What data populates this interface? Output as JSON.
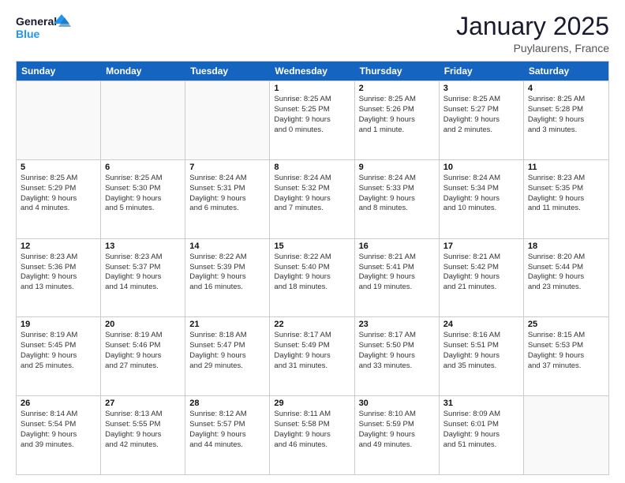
{
  "logo": {
    "line1": "General",
    "line2": "Blue"
  },
  "title": "January 2025",
  "subtitle": "Puylaurens, France",
  "header_days": [
    "Sunday",
    "Monday",
    "Tuesday",
    "Wednesday",
    "Thursday",
    "Friday",
    "Saturday"
  ],
  "weeks": [
    [
      {
        "day": "",
        "empty": true,
        "lines": []
      },
      {
        "day": "",
        "empty": true,
        "lines": []
      },
      {
        "day": "",
        "empty": true,
        "lines": []
      },
      {
        "day": "1",
        "lines": [
          "Sunrise: 8:25 AM",
          "Sunset: 5:25 PM",
          "Daylight: 9 hours",
          "and 0 minutes."
        ]
      },
      {
        "day": "2",
        "lines": [
          "Sunrise: 8:25 AM",
          "Sunset: 5:26 PM",
          "Daylight: 9 hours",
          "and 1 minute."
        ]
      },
      {
        "day": "3",
        "lines": [
          "Sunrise: 8:25 AM",
          "Sunset: 5:27 PM",
          "Daylight: 9 hours",
          "and 2 minutes."
        ]
      },
      {
        "day": "4",
        "lines": [
          "Sunrise: 8:25 AM",
          "Sunset: 5:28 PM",
          "Daylight: 9 hours",
          "and 3 minutes."
        ]
      }
    ],
    [
      {
        "day": "5",
        "lines": [
          "Sunrise: 8:25 AM",
          "Sunset: 5:29 PM",
          "Daylight: 9 hours",
          "and 4 minutes."
        ]
      },
      {
        "day": "6",
        "lines": [
          "Sunrise: 8:25 AM",
          "Sunset: 5:30 PM",
          "Daylight: 9 hours",
          "and 5 minutes."
        ]
      },
      {
        "day": "7",
        "lines": [
          "Sunrise: 8:24 AM",
          "Sunset: 5:31 PM",
          "Daylight: 9 hours",
          "and 6 minutes."
        ]
      },
      {
        "day": "8",
        "lines": [
          "Sunrise: 8:24 AM",
          "Sunset: 5:32 PM",
          "Daylight: 9 hours",
          "and 7 minutes."
        ]
      },
      {
        "day": "9",
        "lines": [
          "Sunrise: 8:24 AM",
          "Sunset: 5:33 PM",
          "Daylight: 9 hours",
          "and 8 minutes."
        ]
      },
      {
        "day": "10",
        "lines": [
          "Sunrise: 8:24 AM",
          "Sunset: 5:34 PM",
          "Daylight: 9 hours",
          "and 10 minutes."
        ]
      },
      {
        "day": "11",
        "lines": [
          "Sunrise: 8:23 AM",
          "Sunset: 5:35 PM",
          "Daylight: 9 hours",
          "and 11 minutes."
        ]
      }
    ],
    [
      {
        "day": "12",
        "lines": [
          "Sunrise: 8:23 AM",
          "Sunset: 5:36 PM",
          "Daylight: 9 hours",
          "and 13 minutes."
        ]
      },
      {
        "day": "13",
        "lines": [
          "Sunrise: 8:23 AM",
          "Sunset: 5:37 PM",
          "Daylight: 9 hours",
          "and 14 minutes."
        ]
      },
      {
        "day": "14",
        "lines": [
          "Sunrise: 8:22 AM",
          "Sunset: 5:39 PM",
          "Daylight: 9 hours",
          "and 16 minutes."
        ]
      },
      {
        "day": "15",
        "lines": [
          "Sunrise: 8:22 AM",
          "Sunset: 5:40 PM",
          "Daylight: 9 hours",
          "and 18 minutes."
        ]
      },
      {
        "day": "16",
        "lines": [
          "Sunrise: 8:21 AM",
          "Sunset: 5:41 PM",
          "Daylight: 9 hours",
          "and 19 minutes."
        ]
      },
      {
        "day": "17",
        "lines": [
          "Sunrise: 8:21 AM",
          "Sunset: 5:42 PM",
          "Daylight: 9 hours",
          "and 21 minutes."
        ]
      },
      {
        "day": "18",
        "lines": [
          "Sunrise: 8:20 AM",
          "Sunset: 5:44 PM",
          "Daylight: 9 hours",
          "and 23 minutes."
        ]
      }
    ],
    [
      {
        "day": "19",
        "lines": [
          "Sunrise: 8:19 AM",
          "Sunset: 5:45 PM",
          "Daylight: 9 hours",
          "and 25 minutes."
        ]
      },
      {
        "day": "20",
        "lines": [
          "Sunrise: 8:19 AM",
          "Sunset: 5:46 PM",
          "Daylight: 9 hours",
          "and 27 minutes."
        ]
      },
      {
        "day": "21",
        "lines": [
          "Sunrise: 8:18 AM",
          "Sunset: 5:47 PM",
          "Daylight: 9 hours",
          "and 29 minutes."
        ]
      },
      {
        "day": "22",
        "lines": [
          "Sunrise: 8:17 AM",
          "Sunset: 5:49 PM",
          "Daylight: 9 hours",
          "and 31 minutes."
        ]
      },
      {
        "day": "23",
        "lines": [
          "Sunrise: 8:17 AM",
          "Sunset: 5:50 PM",
          "Daylight: 9 hours",
          "and 33 minutes."
        ]
      },
      {
        "day": "24",
        "lines": [
          "Sunrise: 8:16 AM",
          "Sunset: 5:51 PM",
          "Daylight: 9 hours",
          "and 35 minutes."
        ]
      },
      {
        "day": "25",
        "lines": [
          "Sunrise: 8:15 AM",
          "Sunset: 5:53 PM",
          "Daylight: 9 hours",
          "and 37 minutes."
        ]
      }
    ],
    [
      {
        "day": "26",
        "lines": [
          "Sunrise: 8:14 AM",
          "Sunset: 5:54 PM",
          "Daylight: 9 hours",
          "and 39 minutes."
        ]
      },
      {
        "day": "27",
        "lines": [
          "Sunrise: 8:13 AM",
          "Sunset: 5:55 PM",
          "Daylight: 9 hours",
          "and 42 minutes."
        ]
      },
      {
        "day": "28",
        "lines": [
          "Sunrise: 8:12 AM",
          "Sunset: 5:57 PM",
          "Daylight: 9 hours",
          "and 44 minutes."
        ]
      },
      {
        "day": "29",
        "lines": [
          "Sunrise: 8:11 AM",
          "Sunset: 5:58 PM",
          "Daylight: 9 hours",
          "and 46 minutes."
        ]
      },
      {
        "day": "30",
        "lines": [
          "Sunrise: 8:10 AM",
          "Sunset: 5:59 PM",
          "Daylight: 9 hours",
          "and 49 minutes."
        ]
      },
      {
        "day": "31",
        "lines": [
          "Sunrise: 8:09 AM",
          "Sunset: 6:01 PM",
          "Daylight: 9 hours",
          "and 51 minutes."
        ]
      },
      {
        "day": "",
        "empty": true,
        "lines": []
      }
    ]
  ]
}
